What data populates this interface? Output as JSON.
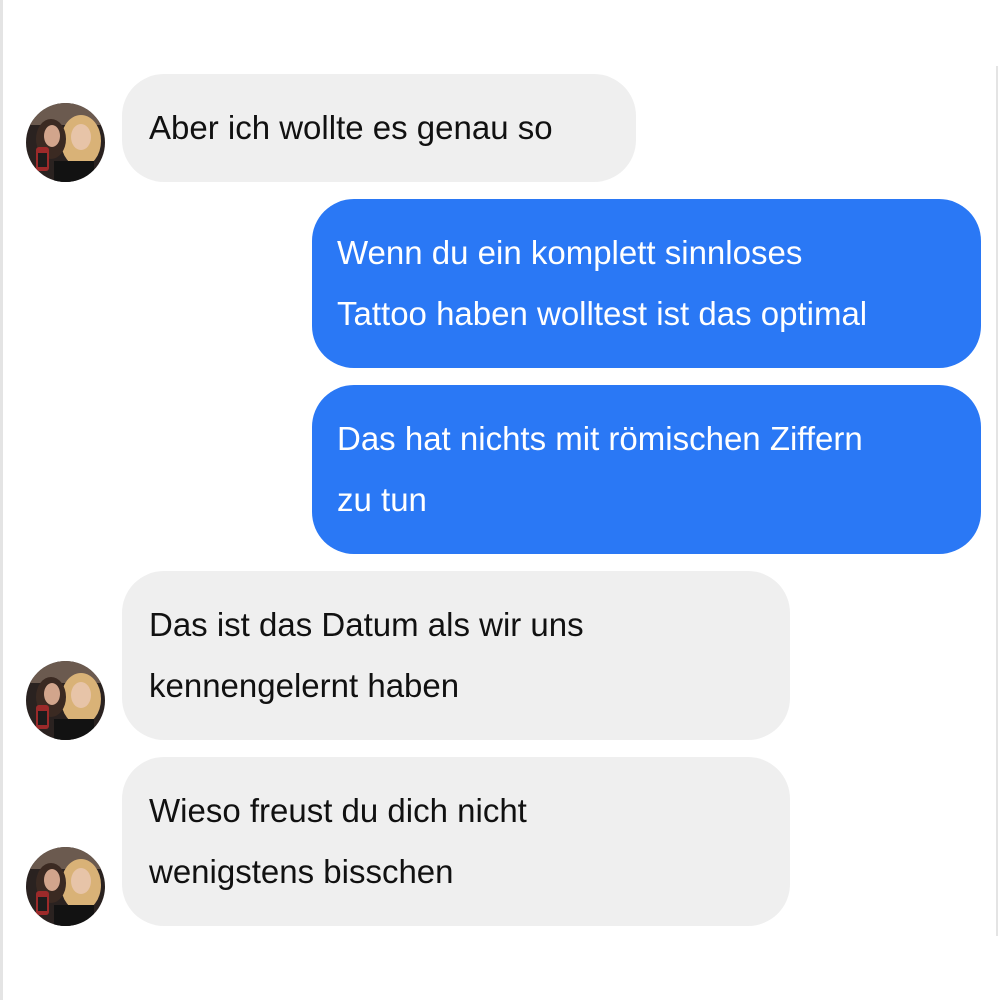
{
  "conversation": {
    "messages": [
      {
        "sender": "contact",
        "lines": [
          "Aber ich wollte es genau so"
        ]
      },
      {
        "sender": "me",
        "lines": [
          "Wenn du ein komplett sinnloses",
          "Tattoo haben wolltest ist das optimal"
        ]
      },
      {
        "sender": "me",
        "lines": [
          "Das hat nichts mit römischen Ziffern",
          "zu tun"
        ]
      },
      {
        "sender": "contact",
        "lines": [
          "Das ist das Datum als wir uns",
          "kennengelernt haben"
        ]
      },
      {
        "sender": "contact",
        "lines": [
          "Wieso freust du dich nicht",
          "wenigstens bisschen"
        ]
      }
    ]
  },
  "colors": {
    "incoming_bubble": "#efefef",
    "outgoing_bubble": "#2a78f5",
    "incoming_text": "#111111",
    "outgoing_text": "#ffffff"
  },
  "icons": {
    "avatar": "contact-avatar-photo"
  }
}
